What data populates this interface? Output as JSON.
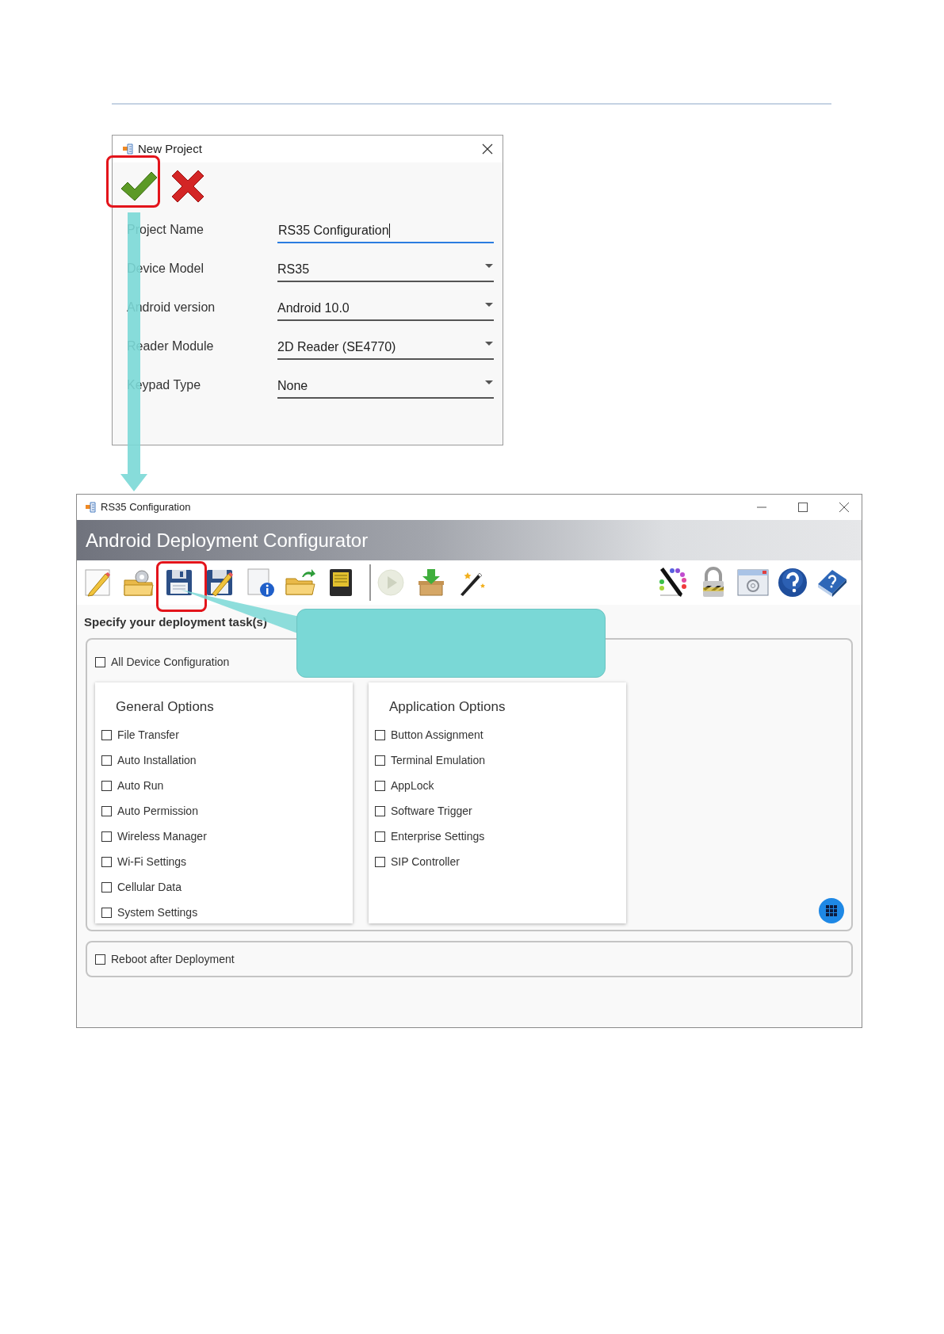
{
  "dialog": {
    "title": "New Project",
    "confirm": {
      "highlighted": true
    },
    "fields": [
      {
        "label": "Project Name",
        "kind": "text",
        "value": "RS35 Configuration",
        "focused": true
      },
      {
        "label": "Device Model",
        "kind": "dropdown",
        "value": "RS35",
        "focused": false
      },
      {
        "label": "Android version",
        "kind": "dropdown",
        "value": "Android 10.0",
        "focused": false
      },
      {
        "label": "Reader Module",
        "kind": "dropdown",
        "value": "2D Reader (SE4770)",
        "focused": false
      },
      {
        "label": "Keypad Type",
        "kind": "dropdown",
        "value": "None",
        "focused": false
      }
    ]
  },
  "window": {
    "title": "RS35 Configuration",
    "header": "Android Deployment Configurator",
    "save_button": {
      "highlighted": true
    },
    "toolbar": [
      {
        "kind": "new"
      },
      {
        "kind": "open-settings"
      },
      {
        "kind": "save"
      },
      {
        "kind": "save-as"
      },
      {
        "kind": "info"
      },
      {
        "kind": "export"
      },
      {
        "kind": "sd-card"
      },
      {
        "kind": "separator"
      },
      {
        "kind": "play"
      },
      {
        "kind": "install"
      },
      {
        "kind": "wand"
      }
    ],
    "toolbar_right": [
      {
        "kind": "palette"
      },
      {
        "kind": "lock"
      },
      {
        "kind": "window-settings"
      },
      {
        "kind": "help"
      },
      {
        "kind": "manual"
      }
    ],
    "section_label": "Specify your deployment task(s)",
    "all_device": {
      "label": "All Device Configuration",
      "checked": false
    },
    "panels": [
      {
        "title": "General Options",
        "items": [
          {
            "label": "File Transfer",
            "checked": false
          },
          {
            "label": "Auto Installation",
            "checked": false
          },
          {
            "label": "Auto Run",
            "checked": false
          },
          {
            "label": "Auto Permission",
            "checked": false
          },
          {
            "label": "Wireless Manager",
            "checked": false
          },
          {
            "label": "Wi-Fi Settings",
            "checked": false
          },
          {
            "label": "Cellular Data",
            "checked": false
          },
          {
            "label": "System Settings",
            "checked": false
          }
        ]
      },
      {
        "title": "Application Options",
        "items": [
          {
            "label": "Button Assignment",
            "checked": false
          },
          {
            "label": "Terminal Emulation",
            "checked": false
          },
          {
            "label": "AppLock",
            "checked": false
          },
          {
            "label": "Software Trigger",
            "checked": false
          },
          {
            "label": "Enterprise Settings",
            "checked": false
          },
          {
            "label": "SIP Controller",
            "checked": false
          }
        ]
      }
    ],
    "reboot": {
      "label": "Reboot after Deployment",
      "checked": false
    }
  }
}
